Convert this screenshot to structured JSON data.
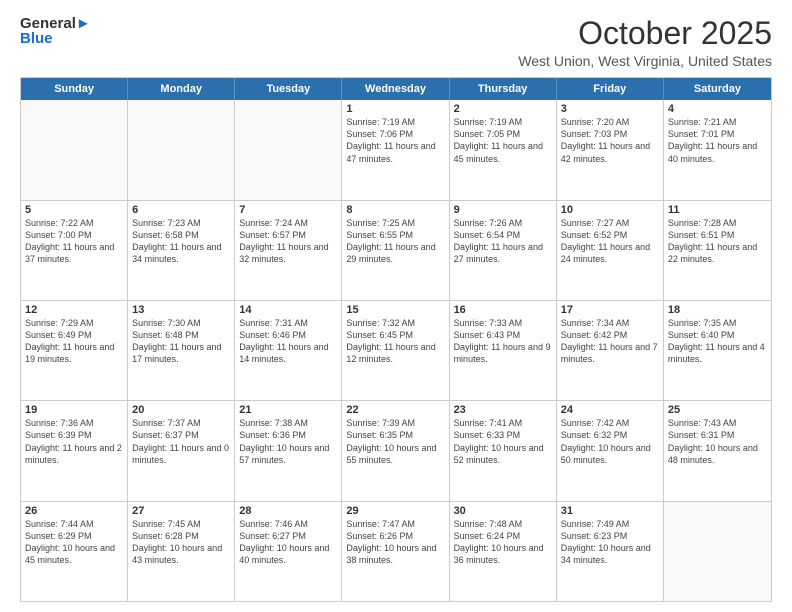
{
  "header": {
    "logo_general": "General",
    "logo_blue": "Blue",
    "month": "October 2025",
    "location": "West Union, West Virginia, United States"
  },
  "days_of_week": [
    "Sunday",
    "Monday",
    "Tuesday",
    "Wednesday",
    "Thursday",
    "Friday",
    "Saturday"
  ],
  "rows": [
    [
      {
        "day": "",
        "sunrise": "",
        "sunset": "",
        "daylight": "",
        "empty": true
      },
      {
        "day": "",
        "sunrise": "",
        "sunset": "",
        "daylight": "",
        "empty": true
      },
      {
        "day": "",
        "sunrise": "",
        "sunset": "",
        "daylight": "",
        "empty": true
      },
      {
        "day": "1",
        "sunrise": "Sunrise: 7:19 AM",
        "sunset": "Sunset: 7:06 PM",
        "daylight": "Daylight: 11 hours and 47 minutes."
      },
      {
        "day": "2",
        "sunrise": "Sunrise: 7:19 AM",
        "sunset": "Sunset: 7:05 PM",
        "daylight": "Daylight: 11 hours and 45 minutes."
      },
      {
        "day": "3",
        "sunrise": "Sunrise: 7:20 AM",
        "sunset": "Sunset: 7:03 PM",
        "daylight": "Daylight: 11 hours and 42 minutes."
      },
      {
        "day": "4",
        "sunrise": "Sunrise: 7:21 AM",
        "sunset": "Sunset: 7:01 PM",
        "daylight": "Daylight: 11 hours and 40 minutes."
      }
    ],
    [
      {
        "day": "5",
        "sunrise": "Sunrise: 7:22 AM",
        "sunset": "Sunset: 7:00 PM",
        "daylight": "Daylight: 11 hours and 37 minutes."
      },
      {
        "day": "6",
        "sunrise": "Sunrise: 7:23 AM",
        "sunset": "Sunset: 6:58 PM",
        "daylight": "Daylight: 11 hours and 34 minutes."
      },
      {
        "day": "7",
        "sunrise": "Sunrise: 7:24 AM",
        "sunset": "Sunset: 6:57 PM",
        "daylight": "Daylight: 11 hours and 32 minutes."
      },
      {
        "day": "8",
        "sunrise": "Sunrise: 7:25 AM",
        "sunset": "Sunset: 6:55 PM",
        "daylight": "Daylight: 11 hours and 29 minutes."
      },
      {
        "day": "9",
        "sunrise": "Sunrise: 7:26 AM",
        "sunset": "Sunset: 6:54 PM",
        "daylight": "Daylight: 11 hours and 27 minutes."
      },
      {
        "day": "10",
        "sunrise": "Sunrise: 7:27 AM",
        "sunset": "Sunset: 6:52 PM",
        "daylight": "Daylight: 11 hours and 24 minutes."
      },
      {
        "day": "11",
        "sunrise": "Sunrise: 7:28 AM",
        "sunset": "Sunset: 6:51 PM",
        "daylight": "Daylight: 11 hours and 22 minutes."
      }
    ],
    [
      {
        "day": "12",
        "sunrise": "Sunrise: 7:29 AM",
        "sunset": "Sunset: 6:49 PM",
        "daylight": "Daylight: 11 hours and 19 minutes."
      },
      {
        "day": "13",
        "sunrise": "Sunrise: 7:30 AM",
        "sunset": "Sunset: 6:48 PM",
        "daylight": "Daylight: 11 hours and 17 minutes."
      },
      {
        "day": "14",
        "sunrise": "Sunrise: 7:31 AM",
        "sunset": "Sunset: 6:46 PM",
        "daylight": "Daylight: 11 hours and 14 minutes."
      },
      {
        "day": "15",
        "sunrise": "Sunrise: 7:32 AM",
        "sunset": "Sunset: 6:45 PM",
        "daylight": "Daylight: 11 hours and 12 minutes."
      },
      {
        "day": "16",
        "sunrise": "Sunrise: 7:33 AM",
        "sunset": "Sunset: 6:43 PM",
        "daylight": "Daylight: 11 hours and 9 minutes."
      },
      {
        "day": "17",
        "sunrise": "Sunrise: 7:34 AM",
        "sunset": "Sunset: 6:42 PM",
        "daylight": "Daylight: 11 hours and 7 minutes."
      },
      {
        "day": "18",
        "sunrise": "Sunrise: 7:35 AM",
        "sunset": "Sunset: 6:40 PM",
        "daylight": "Daylight: 11 hours and 4 minutes."
      }
    ],
    [
      {
        "day": "19",
        "sunrise": "Sunrise: 7:36 AM",
        "sunset": "Sunset: 6:39 PM",
        "daylight": "Daylight: 11 hours and 2 minutes."
      },
      {
        "day": "20",
        "sunrise": "Sunrise: 7:37 AM",
        "sunset": "Sunset: 6:37 PM",
        "daylight": "Daylight: 11 hours and 0 minutes."
      },
      {
        "day": "21",
        "sunrise": "Sunrise: 7:38 AM",
        "sunset": "Sunset: 6:36 PM",
        "daylight": "Daylight: 10 hours and 57 minutes."
      },
      {
        "day": "22",
        "sunrise": "Sunrise: 7:39 AM",
        "sunset": "Sunset: 6:35 PM",
        "daylight": "Daylight: 10 hours and 55 minutes."
      },
      {
        "day": "23",
        "sunrise": "Sunrise: 7:41 AM",
        "sunset": "Sunset: 6:33 PM",
        "daylight": "Daylight: 10 hours and 52 minutes."
      },
      {
        "day": "24",
        "sunrise": "Sunrise: 7:42 AM",
        "sunset": "Sunset: 6:32 PM",
        "daylight": "Daylight: 10 hours and 50 minutes."
      },
      {
        "day": "25",
        "sunrise": "Sunrise: 7:43 AM",
        "sunset": "Sunset: 6:31 PM",
        "daylight": "Daylight: 10 hours and 48 minutes."
      }
    ],
    [
      {
        "day": "26",
        "sunrise": "Sunrise: 7:44 AM",
        "sunset": "Sunset: 6:29 PM",
        "daylight": "Daylight: 10 hours and 45 minutes."
      },
      {
        "day": "27",
        "sunrise": "Sunrise: 7:45 AM",
        "sunset": "Sunset: 6:28 PM",
        "daylight": "Daylight: 10 hours and 43 minutes."
      },
      {
        "day": "28",
        "sunrise": "Sunrise: 7:46 AM",
        "sunset": "Sunset: 6:27 PM",
        "daylight": "Daylight: 10 hours and 40 minutes."
      },
      {
        "day": "29",
        "sunrise": "Sunrise: 7:47 AM",
        "sunset": "Sunset: 6:26 PM",
        "daylight": "Daylight: 10 hours and 38 minutes."
      },
      {
        "day": "30",
        "sunrise": "Sunrise: 7:48 AM",
        "sunset": "Sunset: 6:24 PM",
        "daylight": "Daylight: 10 hours and 36 minutes."
      },
      {
        "day": "31",
        "sunrise": "Sunrise: 7:49 AM",
        "sunset": "Sunset: 6:23 PM",
        "daylight": "Daylight: 10 hours and 34 minutes."
      },
      {
        "day": "",
        "sunrise": "",
        "sunset": "",
        "daylight": "",
        "empty": true
      }
    ]
  ]
}
